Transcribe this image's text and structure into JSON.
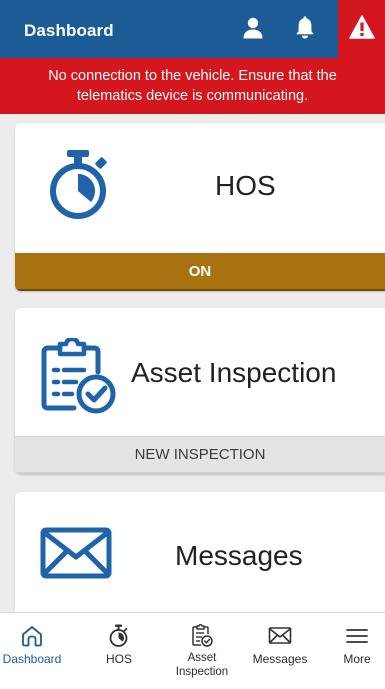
{
  "header": {
    "title": "Dashboard",
    "icons": [
      "user-icon",
      "bell-icon",
      "alert-icon"
    ]
  },
  "banner": {
    "message": "No connection to the vehicle. Ensure that the telematics device is communicating."
  },
  "cards": {
    "hos": {
      "title": "HOS",
      "action": "ON",
      "icon": "stopwatch-icon"
    },
    "asset_inspection": {
      "title": "Asset Inspection",
      "action": "NEW INSPECTION",
      "icon": "clipboard-check-icon"
    },
    "messages": {
      "title": "Messages",
      "icon": "envelope-icon"
    }
  },
  "bottom_nav": {
    "items": [
      {
        "label": "Dashboard",
        "icon": "home-icon",
        "active": true
      },
      {
        "label": "HOS",
        "icon": "stopwatch-icon",
        "active": false
      },
      {
        "label": "Asset Inspection",
        "icon": "clipboard-check-icon",
        "active": false
      },
      {
        "label": "Messages",
        "icon": "envelope-icon",
        "active": false
      },
      {
        "label": "More",
        "icon": "menu-icon",
        "active": false
      }
    ]
  },
  "colors": {
    "header": "#1d5b97",
    "alert": "#d4171e",
    "hos_action": "#a97211",
    "icon_blue": "#1f63a8",
    "background": "#ececec"
  }
}
